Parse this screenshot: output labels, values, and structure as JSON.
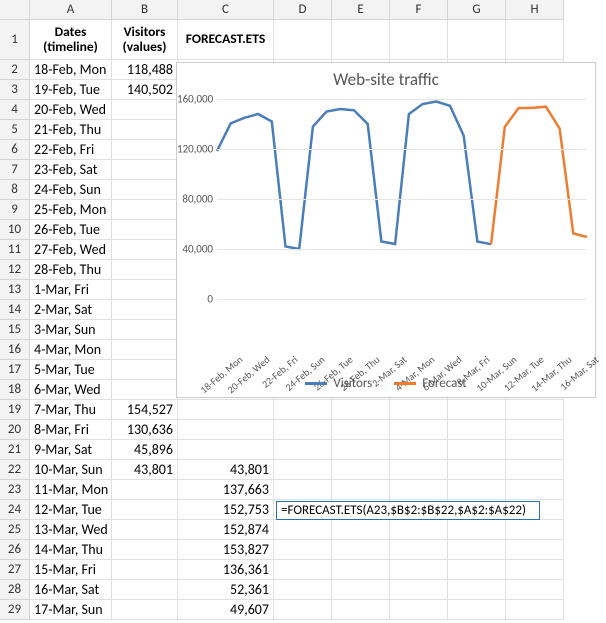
{
  "columns": [
    "A",
    "B",
    "C",
    "D",
    "E",
    "F",
    "G",
    "H"
  ],
  "header_row": {
    "a": "Dates (timeline)",
    "b": "Visitors (values)",
    "c": "FORECAST.ETS"
  },
  "rows": [
    {
      "n": 2,
      "a": "18-Feb, Mon",
      "b": "118,488",
      "c": ""
    },
    {
      "n": 3,
      "a": "19-Feb, Tue",
      "b": "140,502",
      "c": ""
    },
    {
      "n": 4,
      "a": "20-Feb, Wed",
      "b": "",
      "c": ""
    },
    {
      "n": 5,
      "a": "21-Feb, Thu",
      "b": "",
      "c": ""
    },
    {
      "n": 6,
      "a": "22-Feb, Fri",
      "b": "",
      "c": ""
    },
    {
      "n": 7,
      "a": "23-Feb, Sat",
      "b": "",
      "c": ""
    },
    {
      "n": 8,
      "a": "24-Feb, Sun",
      "b": "",
      "c": ""
    },
    {
      "n": 9,
      "a": "25-Feb, Mon",
      "b": "",
      "c": ""
    },
    {
      "n": 10,
      "a": "26-Feb, Tue",
      "b": "",
      "c": ""
    },
    {
      "n": 11,
      "a": "27-Feb, Wed",
      "b": "",
      "c": ""
    },
    {
      "n": 12,
      "a": "28-Feb, Thu",
      "b": "",
      "c": ""
    },
    {
      "n": 13,
      "a": "1-Mar, Fri",
      "b": "",
      "c": ""
    },
    {
      "n": 14,
      "a": "2-Mar, Sat",
      "b": "",
      "c": ""
    },
    {
      "n": 15,
      "a": "3-Mar, Sun",
      "b": "",
      "c": ""
    },
    {
      "n": 16,
      "a": "4-Mar, Mon",
      "b": "",
      "c": ""
    },
    {
      "n": 17,
      "a": "5-Mar, Tue",
      "b": "",
      "c": ""
    },
    {
      "n": 18,
      "a": "6-Mar, Wed",
      "b": "",
      "c": ""
    },
    {
      "n": 19,
      "a": "7-Mar, Thu",
      "b": "154,527",
      "c": ""
    },
    {
      "n": 20,
      "a": "8-Mar, Fri",
      "b": "130,636",
      "c": ""
    },
    {
      "n": 21,
      "a": "9-Mar, Sat",
      "b": "45,896",
      "c": ""
    },
    {
      "n": 22,
      "a": "10-Mar, Sun",
      "b": "43,801",
      "c": "43,801"
    },
    {
      "n": 23,
      "a": "11-Mar, Mon",
      "b": "",
      "c": "137,663"
    },
    {
      "n": 24,
      "a": "12-Mar, Tue",
      "b": "",
      "c": "152,753"
    },
    {
      "n": 25,
      "a": "13-Mar, Wed",
      "b": "",
      "c": "152,874"
    },
    {
      "n": 26,
      "a": "14-Mar, Thu",
      "b": "",
      "c": "153,827"
    },
    {
      "n": 27,
      "a": "15-Mar, Fri",
      "b": "",
      "c": "136,361"
    },
    {
      "n": 28,
      "a": "16-Mar, Sat",
      "b": "",
      "c": "52,361"
    },
    {
      "n": 29,
      "a": "17-Mar, Sun",
      "b": "",
      "c": "49,607"
    }
  ],
  "formula": "=FORECAST.ETS(A23,$B$2:$B$22,$A$2:$A$22)",
  "chart_data": {
    "type": "line",
    "title": "Web-site traffic",
    "ylabel": "",
    "xlabel": "",
    "ylim": [
      0,
      160000
    ],
    "yticks": [
      0,
      40000,
      80000,
      120000,
      160000
    ],
    "ytick_labels": [
      "0",
      "40,000",
      "80,000",
      "120,000",
      "160,000"
    ],
    "categories": [
      "18-Feb, Mon",
      "19-Feb, Tue",
      "20-Feb, Wed",
      "21-Feb, Thu",
      "22-Feb, Fri",
      "23-Feb, Sat",
      "24-Feb, Sun",
      "25-Feb, Mon",
      "26-Feb, Tue",
      "27-Feb, Wed",
      "28-Feb, Thu",
      "1-Mar, Fri",
      "2-Mar, Sat",
      "3-Mar, Sun",
      "4-Mar, Mon",
      "5-Mar, Tue",
      "6-Mar, Wed",
      "7-Mar, Thu",
      "8-Mar, Fri",
      "9-Mar, Sat",
      "10-Mar, Sun",
      "11-Mar, Mon",
      "12-Mar, Tue",
      "13-Mar, Wed",
      "14-Mar, Thu",
      "15-Mar, Fri",
      "16-Mar, Sat",
      "17-Mar, Sun"
    ],
    "xtick_labels": [
      "18-Feb, Mon",
      "20-Feb, Wed",
      "22-Feb, Fri",
      "24-Feb, Sun",
      "26-Feb, Tue",
      "28-Feb, Thu",
      "2-Mar, Sat",
      "4-Mar, Mon",
      "6-Mar, Wed",
      "8-Mar, Fri",
      "10-Mar, Sun",
      "12-Mar, Tue",
      "14-Mar, Thu",
      "16-Mar, Sat"
    ],
    "series": [
      {
        "name": "Visitors",
        "color": "#4a7ebb",
        "values": [
          118488,
          140502,
          145000,
          148000,
          142000,
          42000,
          40000,
          138000,
          150000,
          152000,
          151000,
          140000,
          46000,
          44000,
          148000,
          156000,
          158000,
          154527,
          130636,
          45896,
          43801,
          null,
          null,
          null,
          null,
          null,
          null,
          null
        ]
      },
      {
        "name": "Forecast",
        "color": "#ed7d31",
        "values": [
          null,
          null,
          null,
          null,
          null,
          null,
          null,
          null,
          null,
          null,
          null,
          null,
          null,
          null,
          null,
          null,
          null,
          null,
          null,
          null,
          43801,
          137663,
          152753,
          152874,
          153827,
          136361,
          52361,
          49607
        ]
      }
    ],
    "legend": [
      "Visitors",
      "Forecast"
    ]
  }
}
